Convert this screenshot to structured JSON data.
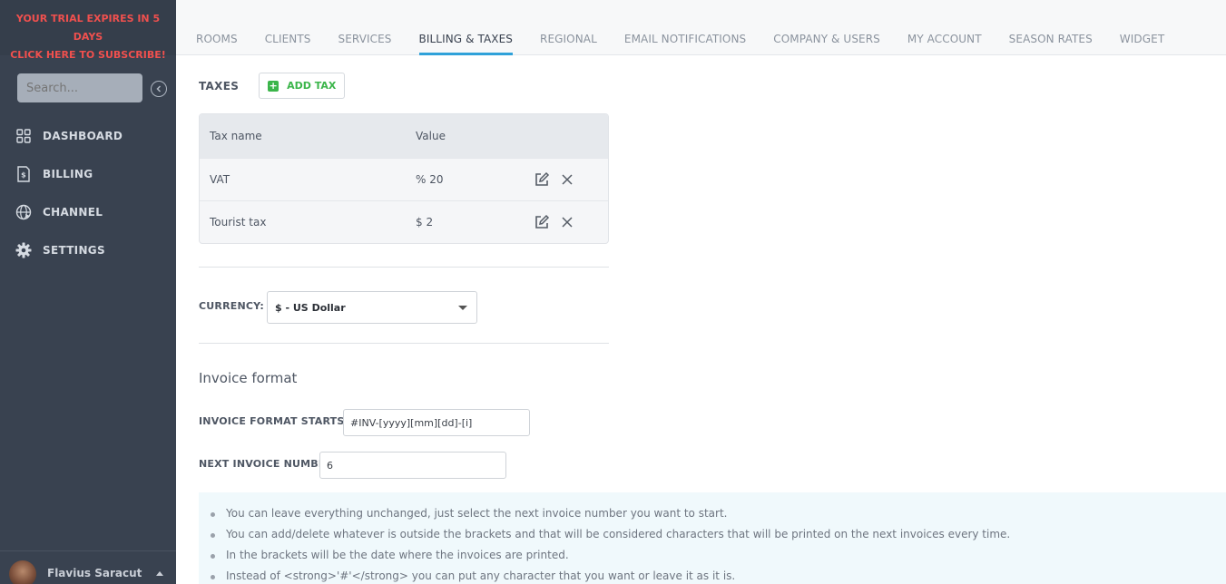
{
  "trial": {
    "line1": "YOUR TRIAL EXPIRES IN 5 DAYS",
    "line2": "CLICK HERE TO SUBSCRIBE!"
  },
  "search": {
    "placeholder": "Search..."
  },
  "sidebar": {
    "items": [
      {
        "label": "DASHBOARD",
        "icon": "grid-icon"
      },
      {
        "label": "BILLING",
        "icon": "invoice-icon"
      },
      {
        "label": "CHANNEL",
        "icon": "globe-icon"
      },
      {
        "label": "SETTINGS",
        "icon": "gear-icon"
      }
    ]
  },
  "user": {
    "name": "Flavius Saracut"
  },
  "tabs": [
    {
      "label": "ROOMS"
    },
    {
      "label": "CLIENTS"
    },
    {
      "label": "SERVICES"
    },
    {
      "label": "BILLING & TAXES",
      "active": true
    },
    {
      "label": "REGIONAL"
    },
    {
      "label": "EMAIL NOTIFICATIONS"
    },
    {
      "label": "COMPANY & USERS"
    },
    {
      "label": "MY ACCOUNT"
    },
    {
      "label": "SEASON RATES"
    },
    {
      "label": "WIDGET"
    }
  ],
  "taxes": {
    "title": "TAXES",
    "add_label": "ADD TAX",
    "columns": {
      "name": "Tax name",
      "value": "Value"
    },
    "rows": [
      {
        "name": "VAT",
        "value": "% 20"
      },
      {
        "name": "Tourist tax",
        "value": "$ 2"
      }
    ]
  },
  "currency": {
    "label": "CURRENCY:",
    "selected": "$ - US Dollar"
  },
  "invoice": {
    "title": "Invoice format",
    "format_label": "INVOICE FORMAT STARTS AT:",
    "format_value": "#INV-[yyyy][mm][dd]-[i]",
    "next_label": "NEXT INVOICE NUMBER:",
    "next_value": "6"
  },
  "info": [
    "You can leave everything unchanged, just select the next invoice number you want to start.",
    "You can add/delete whatever is outside the brackets and that will be considered characters that will be printed on the next invoices every time.",
    "In the brackets will be the date where the invoices are printed.",
    "Instead of <strong>'#'</strong> you can put any character that you want or leave it as it is."
  ],
  "colors": {
    "sidebar_bg": "#394250",
    "trial_text": "#f0504e",
    "accent": "#2fa1d9",
    "add_green": "#3bb54a",
    "info_bg": "#f0f9fc"
  }
}
